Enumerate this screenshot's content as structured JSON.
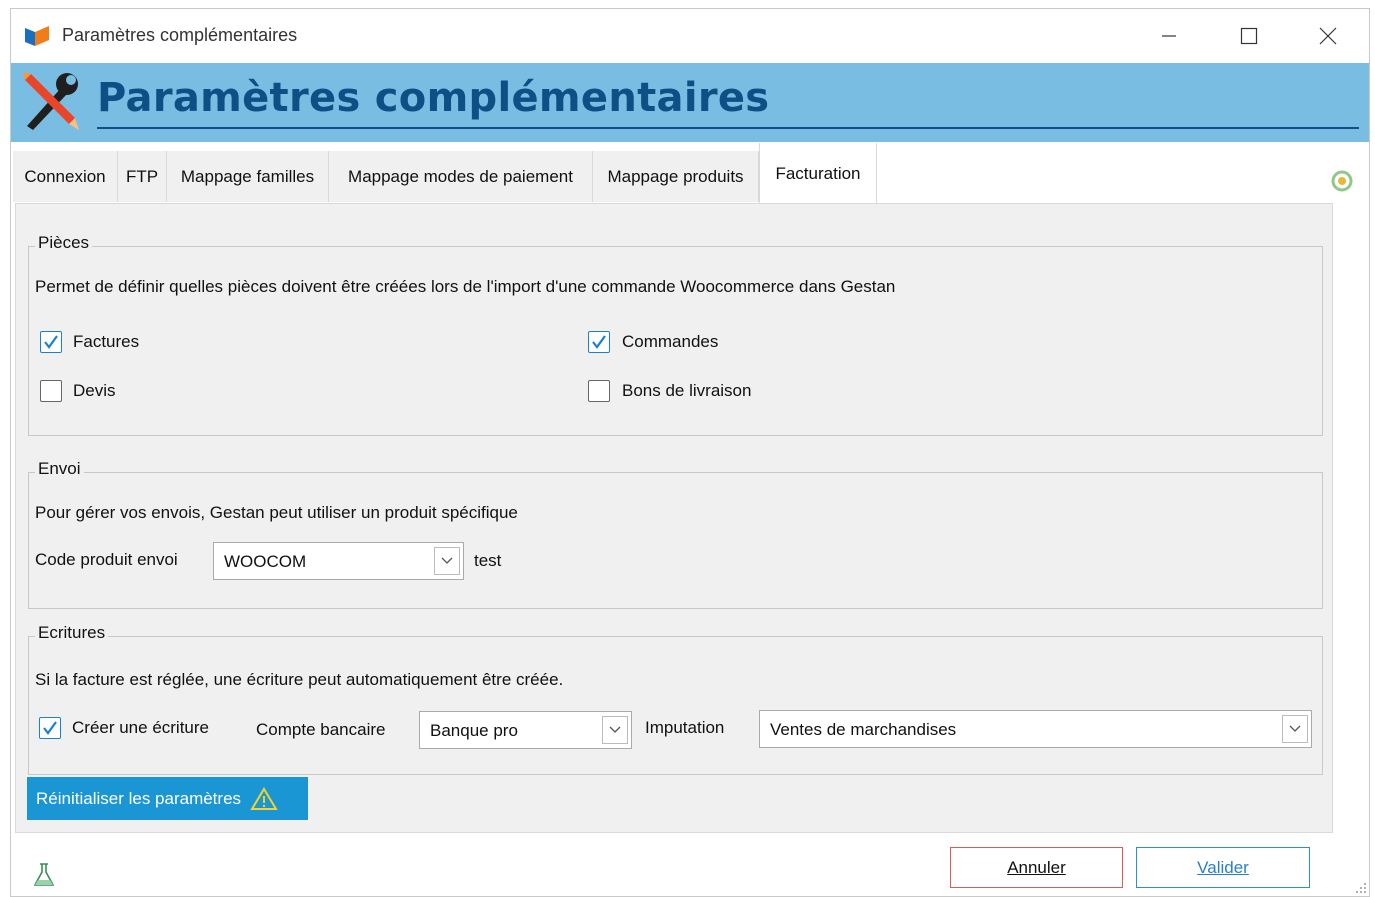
{
  "window": {
    "title": "Paramètres complémentaires"
  },
  "header": {
    "title": "Paramètres complémentaires"
  },
  "tabs": [
    {
      "label": "Connexion"
    },
    {
      "label": "FTP"
    },
    {
      "label": "Mappage familles"
    },
    {
      "label": "Mappage modes de paiement"
    },
    {
      "label": "Mappage produits"
    },
    {
      "label": "Facturation",
      "active": true
    }
  ],
  "pieces": {
    "title": "Pièces",
    "description": "Permet de définir quelles pièces doivent être créées lors de l'import d'une commande Woocommerce dans Gestan",
    "options": [
      {
        "label": "Factures",
        "checked": true
      },
      {
        "label": "Commandes",
        "checked": true
      },
      {
        "label": "Devis",
        "checked": false
      },
      {
        "label": "Bons de livraison",
        "checked": false
      }
    ]
  },
  "envoi": {
    "title": "Envoi",
    "description": "Pour gérer vos envois, Gestan peut utiliser un produit spécifique",
    "code_label": "Code produit envoi",
    "code_value": "WOOCOM",
    "code_desc": "test"
  },
  "ecritures": {
    "title": "Ecritures",
    "description": "Si la facture est réglée, une écriture peut automatiquement être créée.",
    "create_label": "Créer une écriture",
    "create_checked": true,
    "compte_label": "Compte bancaire",
    "compte_value": "Banque pro",
    "imputation_label": "Imputation",
    "imputation_value": "Ventes de marchandises"
  },
  "reset_label": "Réinitialiser les paramètres",
  "buttons": {
    "cancel": "Annuler",
    "ok": "Valider"
  },
  "colors": {
    "banner": "#79bde2",
    "title": "#0f4f86",
    "reset": "#1a96d4",
    "check": "#1c7fd0"
  }
}
